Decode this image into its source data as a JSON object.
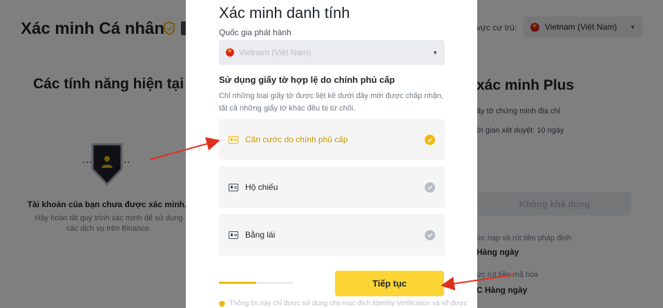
{
  "background": {
    "page_title": "Xác minh Cá nhân",
    "region_label": "u vực cư trú:",
    "region_value": "Vietnam (Việt Nam)",
    "current_features_heading": "Các tính năng hiện tại",
    "unverified_title": "Tài khoản của bạn chưa được xác minh.",
    "unverified_desc": "Hãy hoàn tất quy trình xác minh để sử dụng các dịch vụ trên Binance.",
    "plus_heading": "xác minh Plus",
    "plus_features": [
      "ấy tờ chứng minh địa chỉ",
      "ời gian xét duyệt: 10 ngày"
    ],
    "unavailable_label": "Không khả dụng",
    "limits": [
      {
        "label": "ức nạp và rút tiền pháp định",
        "value": "Hàng ngày"
      },
      {
        "label": "ức rút tiền mã hóa",
        "value": "C Hàng ngày"
      }
    ]
  },
  "modal": {
    "title": "Xác minh danh tính",
    "country_label": "Quốc gia phát hành",
    "country_value": "Vietnam (Việt Nam)",
    "section_heading": "Sử dụng giấy tờ hợp lệ do chính phủ cấp",
    "section_desc": "Chỉ những loại giấy tờ được liệt kê dưới đây mới được chấp nhận, tất cả những giấy tờ khác đều bị từ chối.",
    "documents": [
      {
        "label": "Căn cước do chính phủ cấp",
        "selected": true,
        "icon": "id-card-icon"
      },
      {
        "label": "Hộ chiếu",
        "selected": false,
        "icon": "passport-icon"
      },
      {
        "label": "Bằng lái",
        "selected": false,
        "icon": "driver-license-icon"
      }
    ],
    "progress": 0.5,
    "continue_label": "Tiếp tục",
    "footer_note": "Thông tin này chỉ được sử dụng cho mục đích Identity Verification và sẽ được"
  },
  "colors": {
    "accent": "#fcd535",
    "selected": "#f0b90b",
    "arrow": "#e0311e",
    "overlay": "rgba(0,0,0,0.5)"
  }
}
